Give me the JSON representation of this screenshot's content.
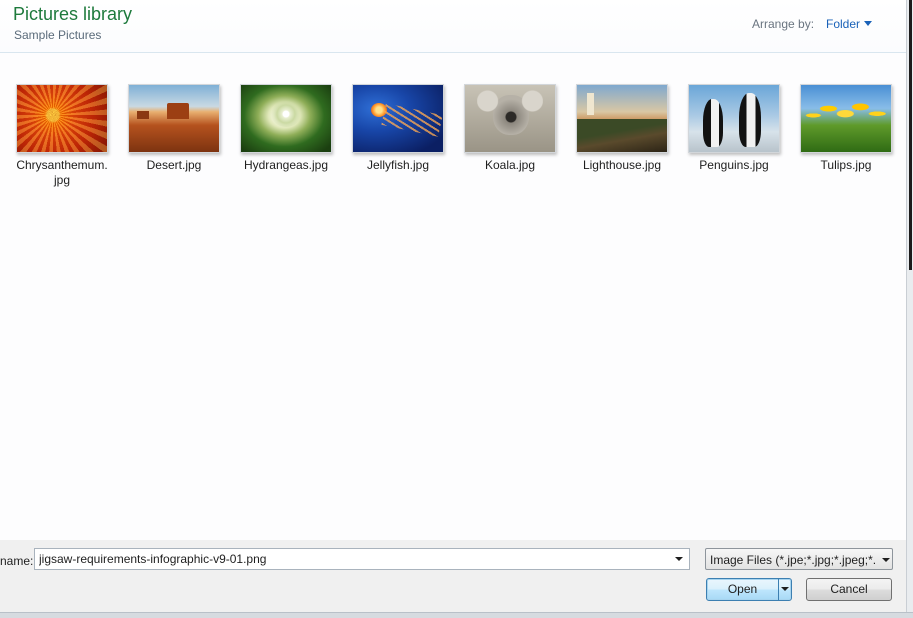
{
  "header": {
    "title": "Pictures library",
    "subtitle": "Sample Pictures",
    "arrange_label": "Arrange by:",
    "arrange_value": "Folder"
  },
  "items": [
    {
      "label": "Chrysanthemum.\njpg",
      "icon": "chrysanthemum-thumbnail"
    },
    {
      "label": "Desert.jpg",
      "icon": "desert-thumbnail"
    },
    {
      "label": "Hydrangeas.jpg",
      "icon": "hydrangeas-thumbnail"
    },
    {
      "label": "Jellyfish.jpg",
      "icon": "jellyfish-thumbnail"
    },
    {
      "label": "Koala.jpg",
      "icon": "koala-thumbnail"
    },
    {
      "label": "Lighthouse.jpg",
      "icon": "lighthouse-thumbnail"
    },
    {
      "label": "Penguins.jpg",
      "icon": "penguins-thumbnail"
    },
    {
      "label": "Tulips.jpg",
      "icon": "tulips-thumbnail"
    }
  ],
  "footer": {
    "filename_label": "name:",
    "filename_value": "jigsaw-requirements-infographic-v9-01.png",
    "filter_value": "Image Files (*.jpe;*.jpg;*.jpeg;*.",
    "open_label": "Open",
    "cancel_label": "Cancel"
  },
  "colors": {
    "title": "#1e7a3c",
    "link": "#1a62b8",
    "primary_button_border": "#3c7fb1"
  }
}
